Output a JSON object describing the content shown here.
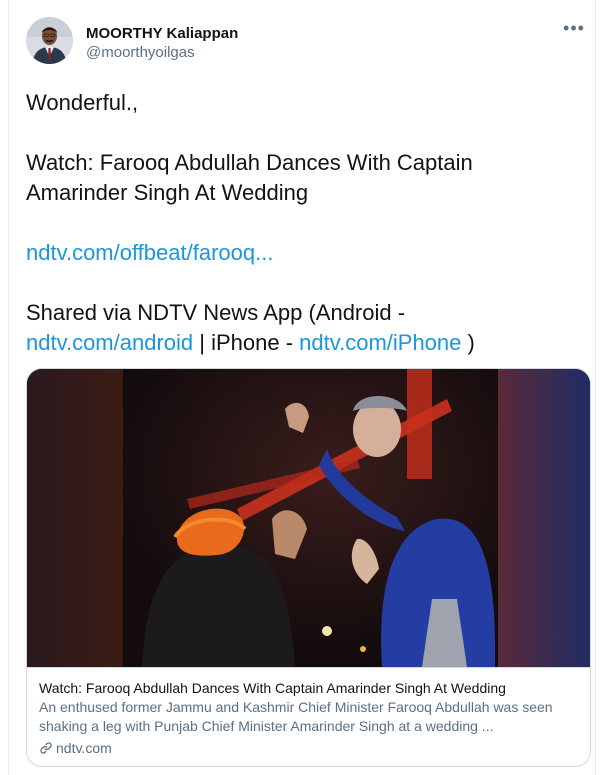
{
  "user": {
    "display_name": "MOORTHY Kaliappan",
    "handle": "@moorthyoilgas",
    "avatar_icon": "profile-photo"
  },
  "menu": {
    "more_label": "•••"
  },
  "tweet": {
    "line1": "Wonderful.,",
    "line2": "Watch: Farooq Abdullah Dances With Captain",
    "line3": "Amarinder Singh At Wedding",
    "link_short": "ndtv.com/offbeat/farooq...",
    "shared_prefix": "Shared via NDTV News App (Android -",
    "link_android": "ndtv.com/android",
    "sep_iphone": " | iPhone - ",
    "link_iphone": "ndtv.com/iPhone",
    "closing": " )"
  },
  "card": {
    "title": "Watch: Farooq Abdullah Dances With Captain Amarinder Singh At Wedding",
    "description": "An enthused former Jammu and Kashmir Chief Minister Farooq Abdullah was seen shaking a leg with Punjab Chief Minister Amarinder Singh at a wedding ...",
    "domain": "ndtv.com"
  },
  "colors": {
    "link": "#1b95e0",
    "secondary_text": "#5b7083",
    "border": "#cfd9de"
  }
}
